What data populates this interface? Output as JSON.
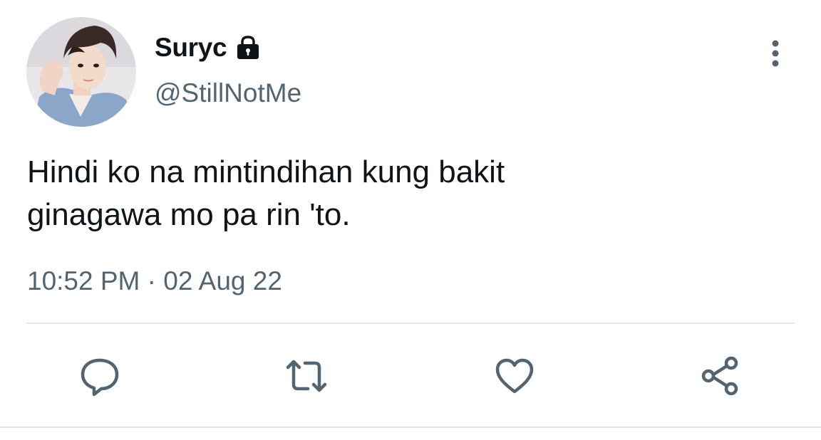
{
  "user": {
    "display_name": "Suryc",
    "handle": "@StillNotMe",
    "avatar": "avatar-photo",
    "protected_icon": "lock-icon"
  },
  "tweet": {
    "text": "Hindi ko na mintindihan kung bakit\nginagawa mo pa rin 'to.",
    "timestamp": "10:52 PM · 02 Aug 22"
  },
  "menu": {
    "icon": "more-vertical-icon"
  },
  "actions": [
    {
      "name": "reply",
      "icon": "reply-icon"
    },
    {
      "name": "retweet",
      "icon": "retweet-icon"
    },
    {
      "name": "like",
      "icon": "heart-icon"
    },
    {
      "name": "share",
      "icon": "share-icon"
    }
  ],
  "colors": {
    "text_primary": "#0f1419",
    "text_secondary": "#536471",
    "icon": "#536471",
    "divider": "#e1e8ed",
    "background": "#ffffff"
  }
}
